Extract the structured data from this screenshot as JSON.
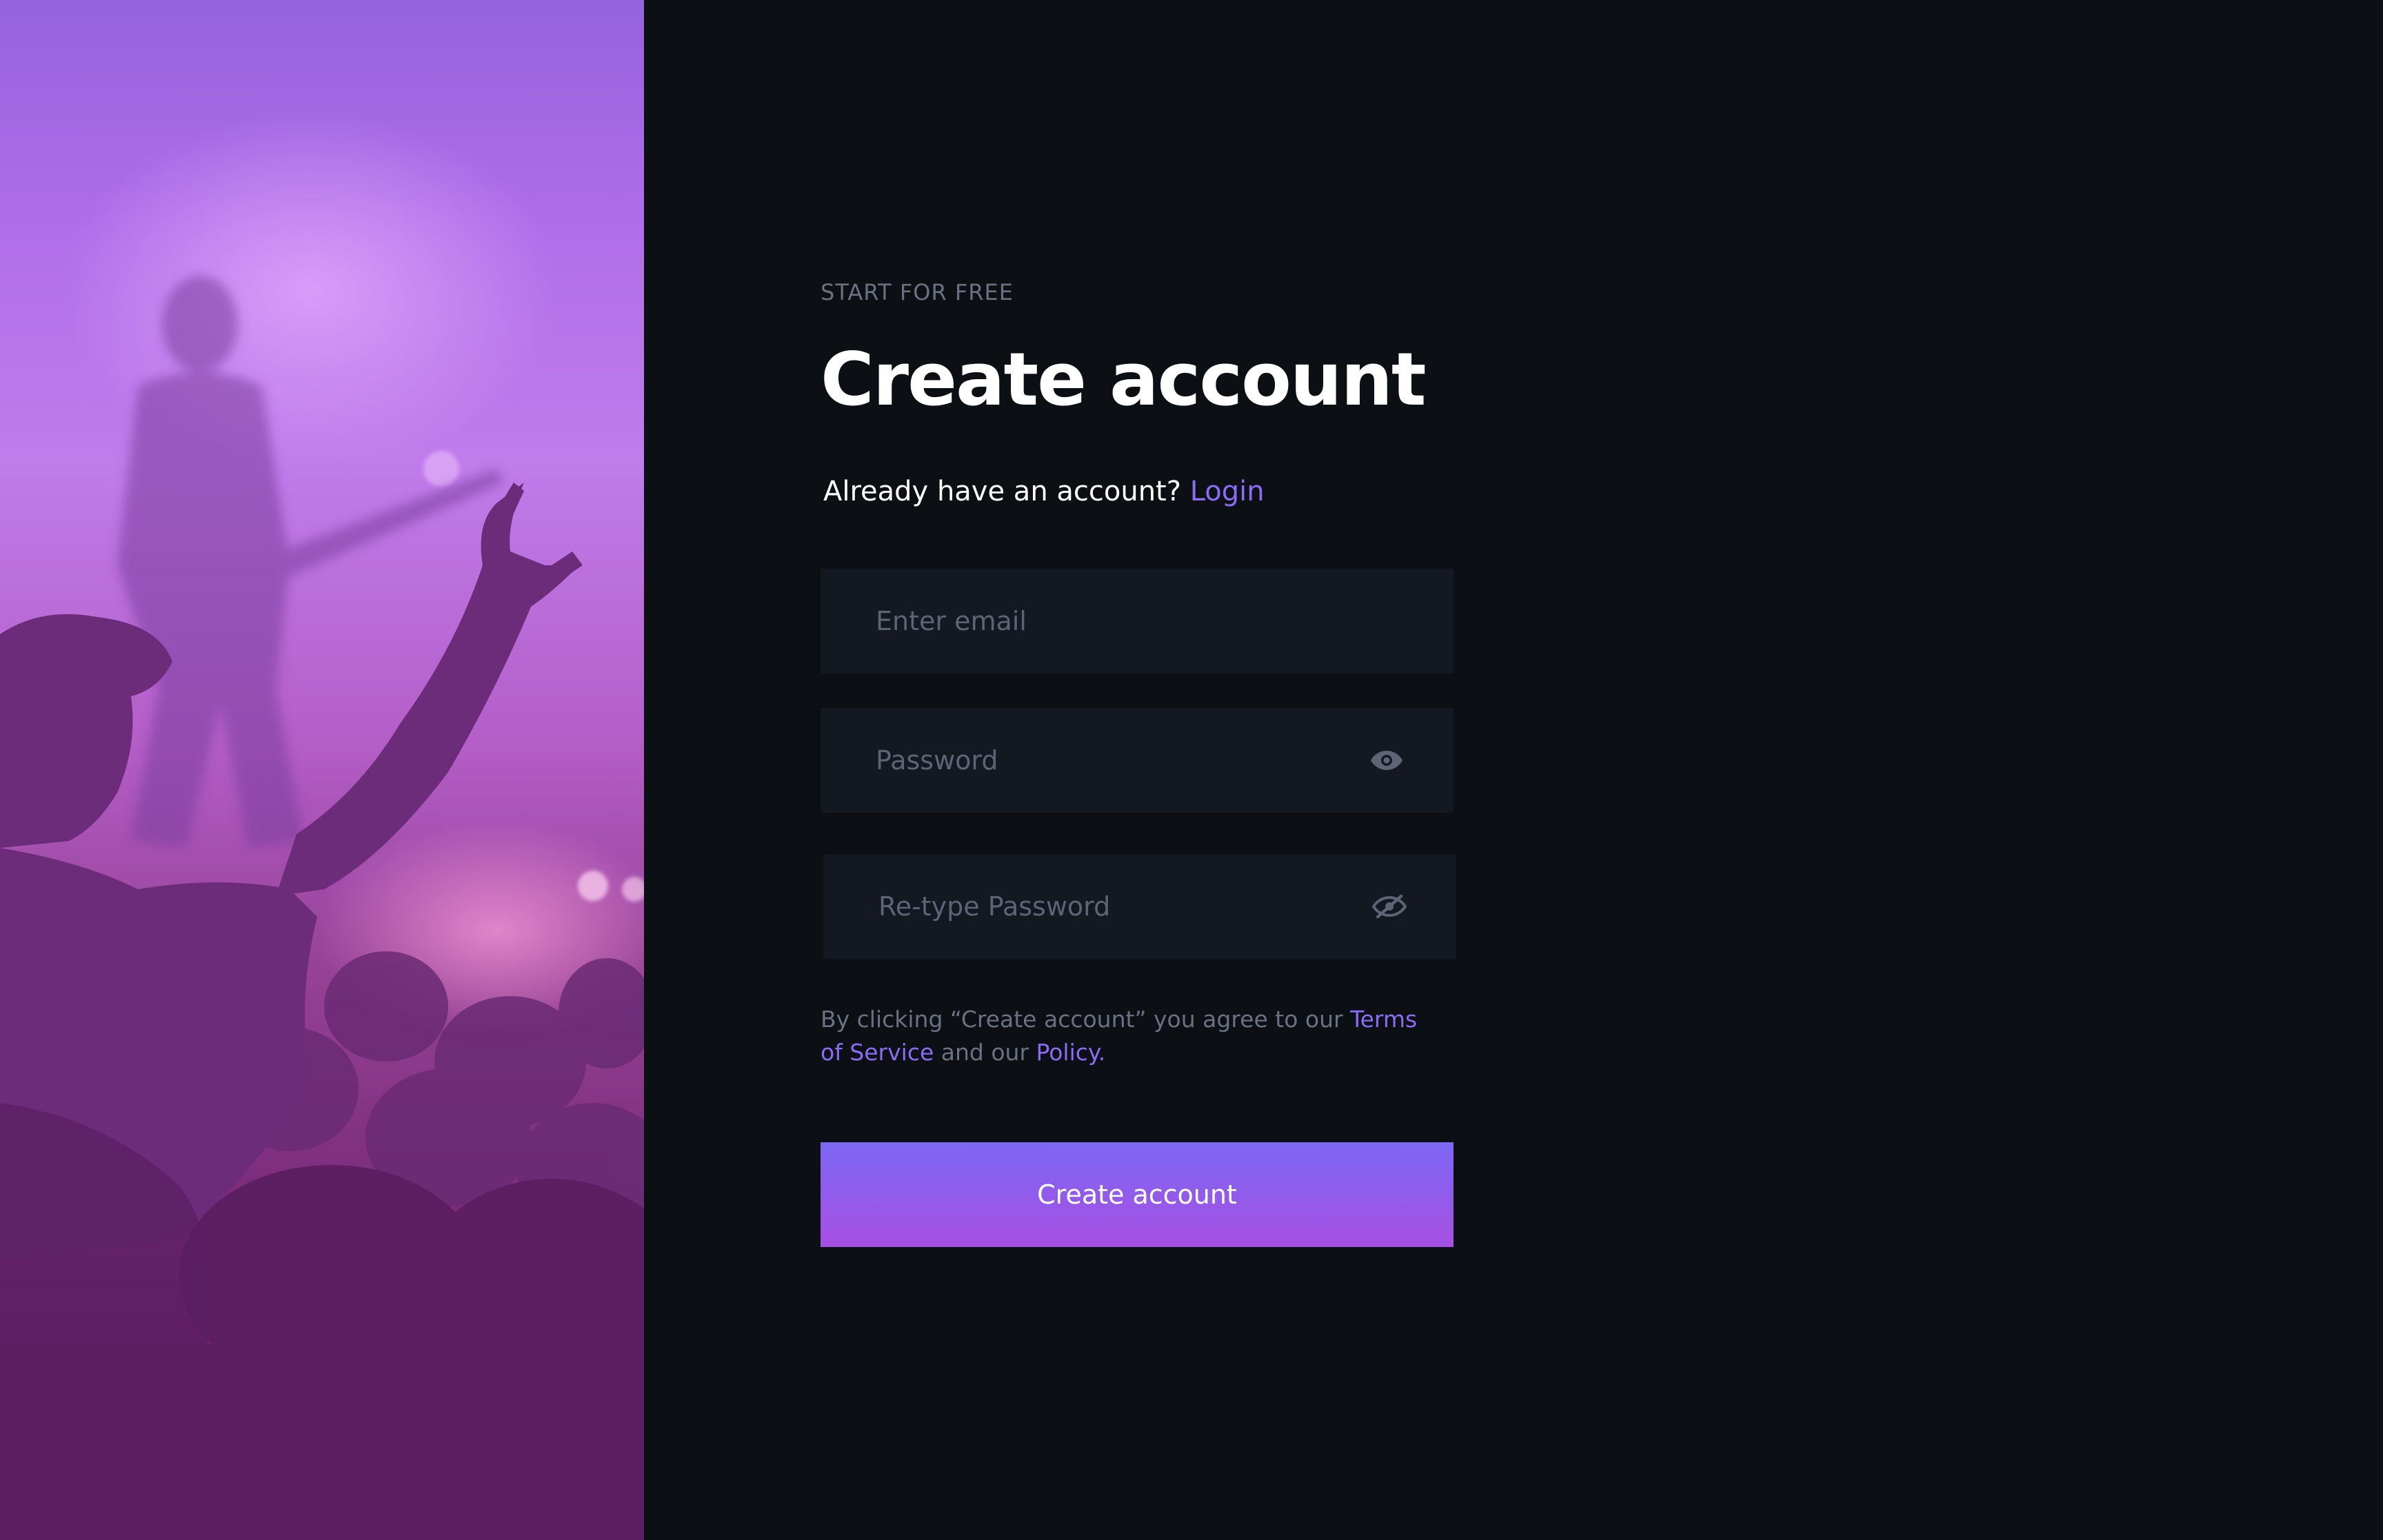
{
  "hero": {
    "image_alt": "Concert crowd with raised hand and guitarist on stage"
  },
  "form": {
    "eyebrow": "START FOR FREE",
    "title": "Create account",
    "already_text": "Already have an account?",
    "login_link": "Login",
    "email_placeholder": "Enter email",
    "password_placeholder": "Password",
    "retype_placeholder": "Re-type Password",
    "terms_prefix": "By clicking “Create account” you agree to our",
    "terms_link": "Terms of Service",
    "terms_mid": "and our",
    "policy_link": "Policy.",
    "submit_label": "Create account"
  },
  "icons": {
    "password_toggle": "eye-icon",
    "retype_toggle": "eye-off-icon"
  },
  "colors": {
    "background": "#0c1015",
    "field_bg": "#141820",
    "accent": "#8b6cf5",
    "button_top": "#7c68f3",
    "button_bottom": "#a74fe3",
    "muted_text": "#6a7282"
  }
}
